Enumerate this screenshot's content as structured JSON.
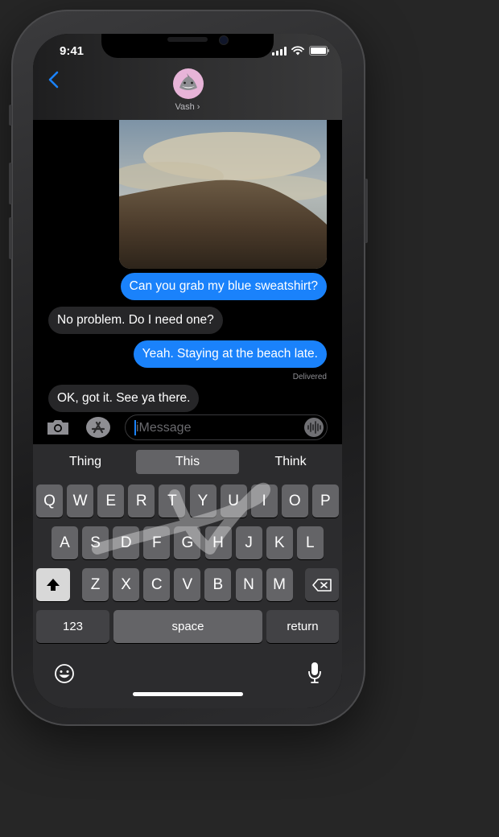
{
  "status_bar": {
    "time": "9:41"
  },
  "header": {
    "contact_name": "Vash ›"
  },
  "messages": [
    {
      "direction": "out",
      "text": "Can you grab my blue sweatshirt?"
    },
    {
      "direction": "in",
      "text": "No problem. Do I need one?"
    },
    {
      "direction": "out",
      "text": "Yeah. Staying at the beach late."
    },
    {
      "direction": "in",
      "text": "OK, got it. See ya there."
    }
  ],
  "delivery_status": "Delivered",
  "compose": {
    "placeholder": "iMessage",
    "value": ""
  },
  "keyboard": {
    "suggestions": [
      "Thing",
      "This",
      "Think"
    ],
    "row1": [
      "Q",
      "W",
      "E",
      "R",
      "T",
      "Y",
      "U",
      "I",
      "O",
      "P"
    ],
    "row2": [
      "A",
      "S",
      "D",
      "F",
      "G",
      "H",
      "J",
      "K",
      "L"
    ],
    "row3": [
      "Z",
      "X",
      "C",
      "V",
      "B",
      "N",
      "M"
    ],
    "numbers_label": "123",
    "space_label": "space",
    "return_label": "return"
  },
  "colors": {
    "accent": "#1a82fb",
    "incoming_bubble": "#262628",
    "avatar_bg": "#e7b4d8"
  }
}
